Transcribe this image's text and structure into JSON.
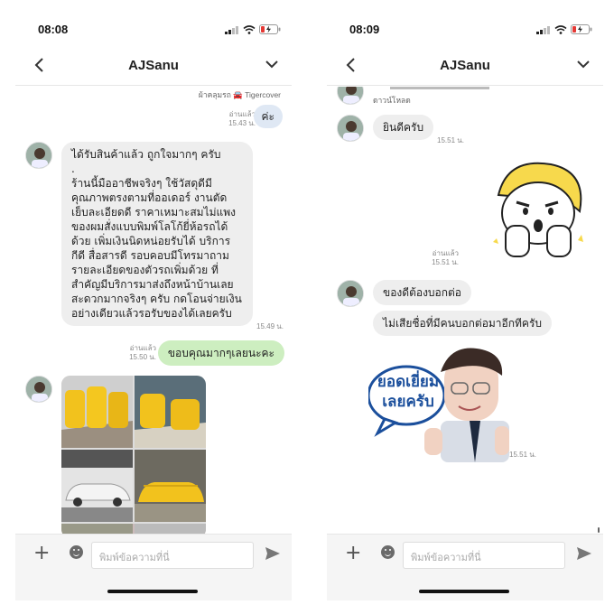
{
  "left": {
    "status_time": "08:08",
    "nav_title": "AJSanu",
    "messages": {
      "caption_top": "ผ้าคลุมรถ 🚘 Tigercover",
      "m1_meta_read": "อ่านแล้ว",
      "m1_meta_time": "15.43 น.",
      "m1_text": "ค่ะ",
      "m2_text": "ได้รับสินค้าแล้ว ถูกใจมากๆ ครับ\n.\nร้านนี้มืออาชีพจริงๆ ใช้วัสดุดีมีคุณภาพตรงตามที่ออเดอร์ งานตัดเย็บละเอียดดี ราคาเหมาะสมไม่แพงของผมสั่งแบบพิมพ์โลโก้ยี่ห้อรถได้ด้วย เพิ่มเงินนิดหน่อยรับได้ บริการกีดี สื่อสารดี รอบคอบมีโทรมาถามรายละเอียดของตัวรถเพิ่มด้วย ที่สำคัญมีบริการมาส่งถึงหน้าบ้านเลย สะดวกมากจริงๆ ครับ กดโอนจ่ายเงินอย่างเดียวแล้วรอรับของได้เลยครับ",
      "m2_time": "15.49 น.",
      "m3_meta_read": "อ่านแล้ว",
      "m3_meta_time": "15.50 น.",
      "m3_text": "ขอบคุณมากๆเลยนะคะ"
    },
    "input_placeholder": "พิมพ์ข้อความที่นี่"
  },
  "right": {
    "status_time": "08:09",
    "nav_title": "AJSanu",
    "messages": {
      "download_label": "ดาวน์โหลด",
      "r1_text": "ยินดีครับ",
      "r1_time": "15.51 น.",
      "r2_meta_read": "อ่านแล้ว",
      "r2_meta_time": "15.51 น.",
      "r3_text": "ของดีต้องบอกต่อ",
      "r4_text": "ไม่เสียชื่อที่มีคนบอกต่อมาอีกทีครับ",
      "sticker_text_line1": "ยอดเยี่ยม",
      "sticker_text_line2": "เลยครับ",
      "r5_time": "15.51 น."
    },
    "input_placeholder": "พิมพ์ข้อความที่นี่"
  },
  "colors": {
    "incoming_bubble": "#eeeeee",
    "outgoing_bubble": "#dfe8f4",
    "green_bubble": "#cdeec0",
    "sticker_yellow": "#f7d94c"
  }
}
